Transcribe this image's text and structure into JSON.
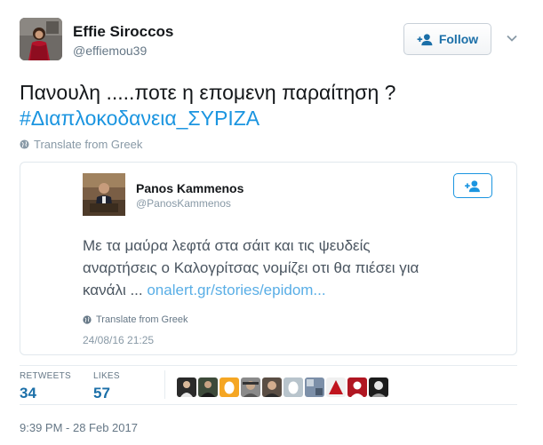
{
  "author": {
    "name": "Effie Siroccos",
    "handle": "@effiemou39",
    "avatar_icon": "profile-photo"
  },
  "follow_button": {
    "label": "Follow",
    "icon": "add-user-icon"
  },
  "tweet": {
    "text_line1": "Πανουλη .....ποτε η  επομενη παραίτηση ?",
    "hashtag": "#Διαπλοκοδανεια_ΣΥΡΙΖΑ",
    "translate_label": "Translate from Greek",
    "timestamp": "9:39 PM - 28 Feb 2017"
  },
  "embedded": {
    "name": "Panos Kammenos",
    "handle": "@PanosKammenos",
    "text_line1": "Με τα μαύρα λεφτά στα σάιτ και τις ψευδείς",
    "text_line2": "αναρτήσεις  ο Καλογρίτσας νομίζει οτι θα πιέσει για",
    "text_line3_prefix": "κανάλι ... ",
    "link": "onalert.gr/stories/epidom...",
    "translate_label": "Translate from Greek",
    "date": "24/08/16 21:25"
  },
  "stats": {
    "retweets_label": "RETWEETS",
    "retweets_value": "34",
    "likes_label": "LIKES",
    "likes_value": "57"
  },
  "colors": {
    "link_blue": "#1b95e0",
    "follow_text": "#1b6fa8",
    "muted_gray": "#657786"
  }
}
